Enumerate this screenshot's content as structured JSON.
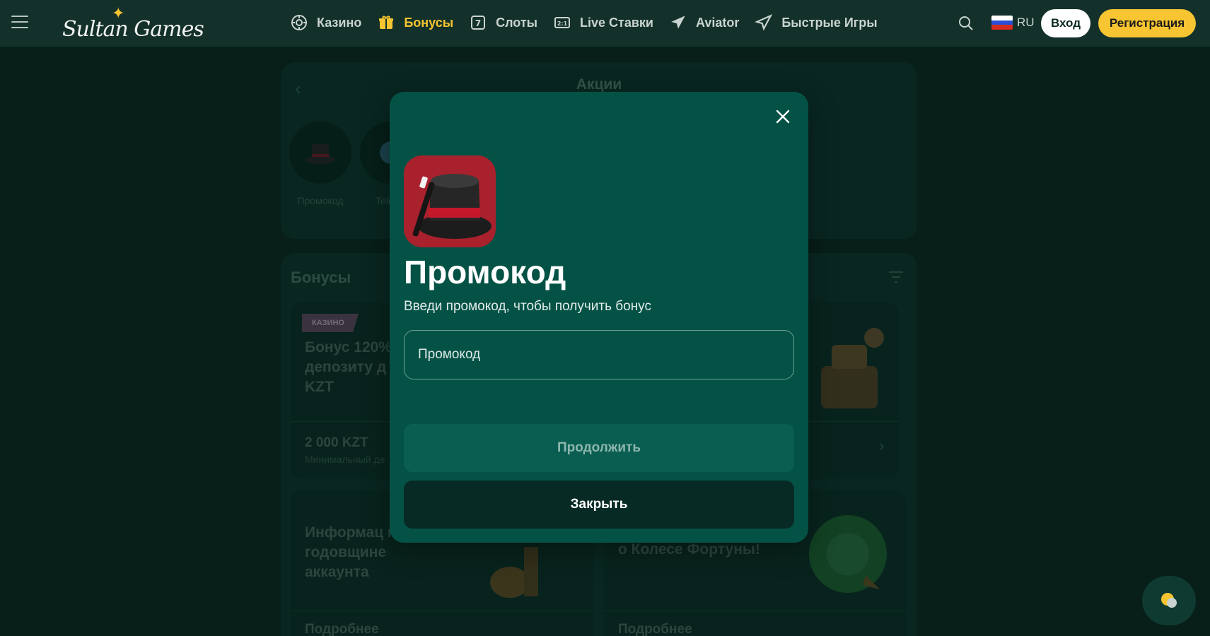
{
  "header": {
    "logo_text": "Sultan Games",
    "nav": [
      {
        "label": "Казино",
        "icon": "casino-chip-icon"
      },
      {
        "label": "Бонусы",
        "icon": "gift-icon",
        "active": true
      },
      {
        "label": "Слоты",
        "icon": "slot-icon"
      },
      {
        "label": "Live Ставки",
        "icon": "live-bet-icon"
      },
      {
        "label": "Aviator",
        "icon": "plane-icon"
      },
      {
        "label": "Быстрые Игры",
        "icon": "rocket-plane-icon"
      }
    ],
    "language": "RU",
    "login_label": "Вход",
    "register_label": "Регистрация"
  },
  "promotions": {
    "title": "Акции",
    "stories": [
      {
        "label": "Промокод"
      },
      {
        "label": "Tele ка"
      }
    ]
  },
  "bonuses": {
    "title": "Бонусы",
    "cards": [
      {
        "badge": "КАЗИНО",
        "title": "Бонус 120% депозиту д KZT",
        "amount": "2 000 KZT",
        "note": "Минимальный де"
      },
      {
        "title": "Информац к годовщине аккаунта",
        "more": "Подробнее"
      },
      {
        "title": "о Колесе Фортуны!",
        "more": "Подробнее"
      }
    ]
  },
  "modal": {
    "title": "Промокод",
    "subtitle": "Введи промокод, чтобы получить бонус",
    "input_placeholder": "Промокод",
    "input_value": "",
    "continue_label": "Продолжить",
    "close_label": "Закрыть"
  },
  "colors": {
    "accent": "#f7c531",
    "modal_bg": "#045246",
    "page_bg": "#0c2a23"
  }
}
